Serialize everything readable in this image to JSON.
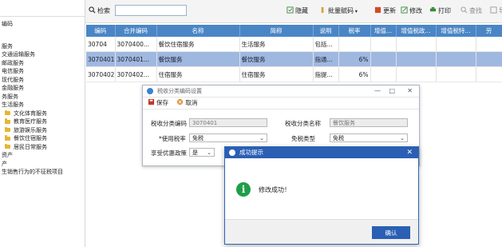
{
  "tree": {
    "top_label": "编码",
    "items": [
      {
        "label": "服务",
        "folder": false,
        "indent": false
      },
      {
        "label": "交通运输服务",
        "folder": false,
        "indent": false
      },
      {
        "label": "邮政服务",
        "folder": false,
        "indent": false
      },
      {
        "label": "电信服务",
        "folder": false,
        "indent": false
      },
      {
        "label": "现代服务",
        "folder": false,
        "indent": false
      },
      {
        "label": "金融服务",
        "folder": false,
        "indent": false
      },
      {
        "label": "务服务",
        "folder": false,
        "indent": false
      },
      {
        "label": "生活服务",
        "folder": false,
        "indent": false
      },
      {
        "label": "文化体育服务",
        "folder": true,
        "indent": true
      },
      {
        "label": "教育医疗服务",
        "folder": true,
        "indent": true
      },
      {
        "label": "旅游娱乐服务",
        "folder": true,
        "indent": true
      },
      {
        "label": "餐饮住宿服务",
        "folder": true,
        "indent": true
      },
      {
        "label": "居民日常服务",
        "folder": true,
        "indent": true
      },
      {
        "label": "资产",
        "folder": false,
        "indent": false
      },
      {
        "label": "产",
        "folder": false,
        "indent": false
      },
      {
        "label": "生销售行为的不征税项目",
        "folder": false,
        "indent": false
      }
    ]
  },
  "toolbar": {
    "search_label": "检索",
    "search_value": "",
    "hide_label": "隐藏",
    "batch_label": "批量赋码",
    "update_label": "更新",
    "edit_label": "修改",
    "print_label": "打印",
    "find_label": "查找",
    "export_label": "导"
  },
  "table": {
    "headers": [
      "编码",
      "合并编码",
      "名称",
      "简称",
      "说明",
      "税率",
      "增值...",
      "增值税政...",
      "增值税特...",
      "劳"
    ],
    "rows": [
      {
        "code": "30704",
        "merged": "3070400...",
        "name": "餐饮住宿服务",
        "short": "生活服务",
        "desc": "包括...",
        "rate": "",
        "selected": false
      },
      {
        "code": "3070401",
        "merged": "3070401...",
        "name": "餐饮服务",
        "short": "餐饮服务",
        "desc": "指通...",
        "rate": "6%",
        "selected": true
      },
      {
        "code": "3070402",
        "merged": "3070402...",
        "name": "住宿服务",
        "short": "住宿服务",
        "desc": "指提...",
        "rate": "6%",
        "selected": false
      }
    ]
  },
  "edit_dialog": {
    "title": "税收分类编码设置",
    "save_label": "保存",
    "cancel_label": "取消",
    "tax_code_label": "税收分类编码",
    "tax_code_value": "3070401",
    "tax_name_label": "税收分类名称",
    "tax_name_value": "餐饮服务",
    "rate_label": "*使用税率",
    "rate_value": "免税",
    "exempt_label": "免税类型",
    "exempt_value": "免税",
    "policy_label": "享受优惠政策",
    "policy_value": "是",
    "minimize": "—",
    "maximize": "□",
    "close": "✕"
  },
  "alert": {
    "title": "成功提示",
    "message": "修改成功！",
    "ok_label": "确认",
    "close": "✕",
    "info_glyph": "i"
  },
  "colors": {
    "header_blue": "#4a86c6",
    "selected_row": "#9fb8e0",
    "alert_title": "#2a5fb4",
    "info_green": "#1e9e4a"
  }
}
